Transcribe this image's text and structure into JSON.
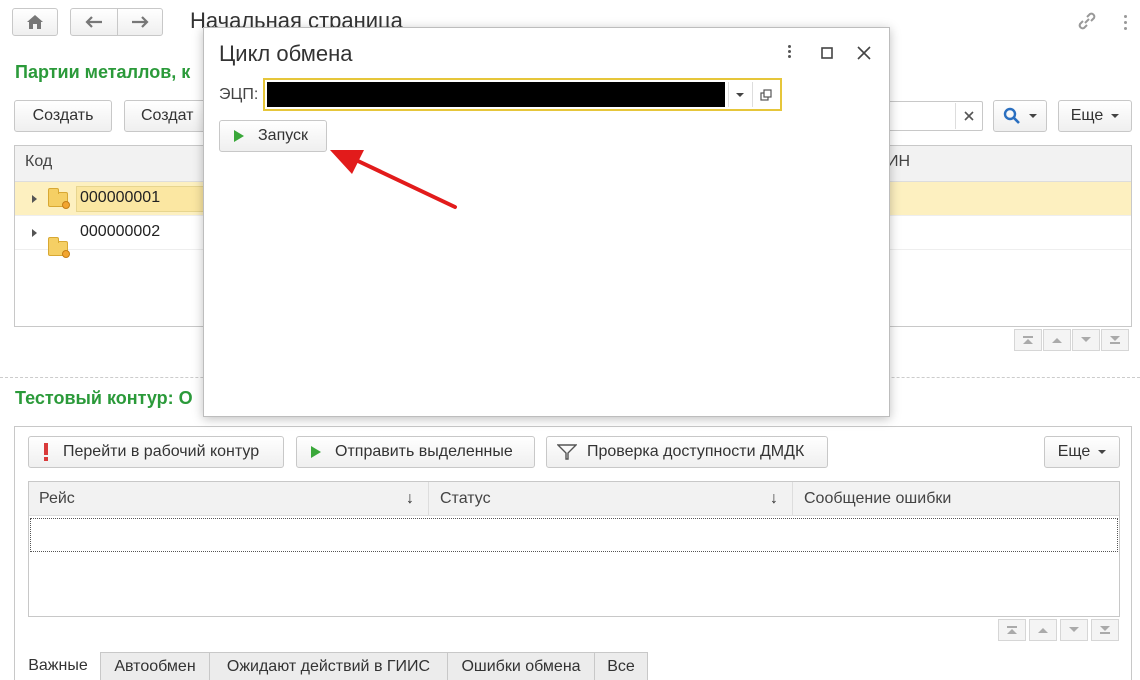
{
  "header": {
    "title": "Начальная страница"
  },
  "section1": {
    "title": "Партии металлов, к",
    "create_label": "Создать",
    "create2_label": "Создат",
    "more_label": "Еще",
    "col_code": "Код",
    "col_right": "ИН",
    "rows": [
      {
        "code": "000000001"
      },
      {
        "code": "000000002"
      }
    ]
  },
  "section2": {
    "title": "Тестовый контур: О",
    "buttons": {
      "goto_work": "Перейти в рабочий контур",
      "send_selected": "Отправить выделенные",
      "check_dmdk": "Проверка доступности ДМДК",
      "more": "Еще"
    },
    "columns": [
      "Рейс",
      "Статус",
      "Сообщение ошибки"
    ],
    "tabs": [
      "Важные",
      "Автообмен",
      "Ожидают действий в ГИИС",
      "Ошибки обмена",
      "Все"
    ]
  },
  "dialog": {
    "title": "Цикл обмена",
    "ecp_label": "ЭЦП:",
    "ecp_value": "",
    "start_label": "Запуск"
  },
  "colors": {
    "accent_green": "#2b9a3a",
    "selected_row": "#fdf0c0",
    "field_border": "#e6c63a",
    "arrow_red": "#e21b1b"
  },
  "icons": [
    "home-icon",
    "arrow-left-icon",
    "arrow-right-icon",
    "link-icon",
    "kebab-icon",
    "search-icon",
    "clear-icon",
    "folder-icon",
    "play-icon",
    "exclamation-icon",
    "filter-icon",
    "sort-down-icon",
    "maximize-icon",
    "close-icon",
    "open-icon"
  ]
}
